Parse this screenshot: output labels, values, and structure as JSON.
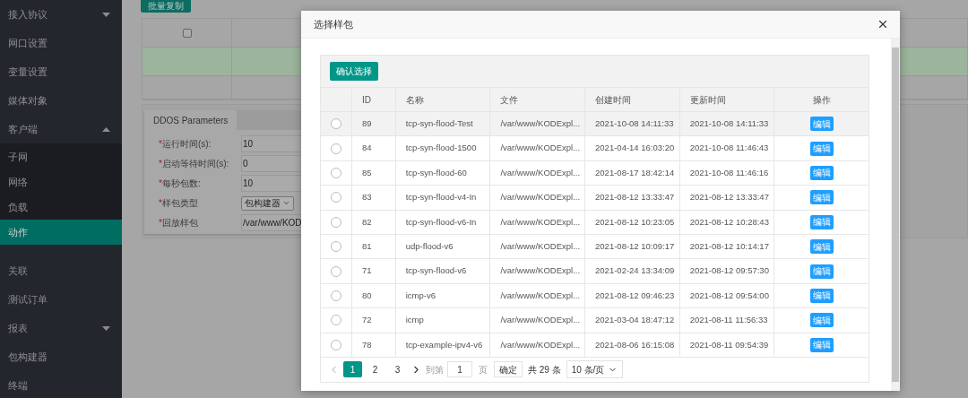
{
  "sidebar": {
    "items": [
      {
        "label": "接入协议",
        "kind": "group",
        "expanded": false,
        "selected": false
      },
      {
        "label": "网口设置",
        "kind": "link",
        "selected": false
      },
      {
        "label": "变量设置",
        "kind": "link",
        "selected": false
      },
      {
        "label": "媒体对象",
        "kind": "link",
        "selected": false
      },
      {
        "label": "客户端",
        "kind": "group",
        "expanded": true,
        "selected": false,
        "children": [
          {
            "label": "子网",
            "selected": false
          },
          {
            "label": "网络",
            "selected": false
          },
          {
            "label": "负载",
            "selected": false
          },
          {
            "label": "动作",
            "selected": true
          }
        ]
      },
      {
        "label": "关联",
        "kind": "link",
        "selected": false
      },
      {
        "label": "测试订单",
        "kind": "link",
        "selected": false
      },
      {
        "label": "报表",
        "kind": "group",
        "expanded": false,
        "selected": false
      },
      {
        "label": "包构建器",
        "kind": "link",
        "selected": false
      },
      {
        "label": "终端",
        "kind": "link",
        "selected": false
      }
    ]
  },
  "page": {
    "batch_button": "批量复制",
    "table": {
      "header_checkbox": {
        "checked": false
      },
      "rows": [
        {
          "selected": true
        },
        {
          "selected": false
        }
      ]
    },
    "params": {
      "tabs": [
        {
          "label": "DDOS Parameters",
          "selected": true
        }
      ],
      "fields": [
        {
          "mark": "*",
          "label": "运行时间(s):",
          "kind": "input",
          "value": "10"
        },
        {
          "mark": "*",
          "label": "启动等待时间(s):",
          "kind": "input",
          "value": "0"
        },
        {
          "mark": "*",
          "label": "每秒包数:",
          "kind": "input",
          "value": "10"
        },
        {
          "mark": "*",
          "label": "样包类型",
          "kind": "select",
          "value": "包构建器"
        },
        {
          "mark": "*",
          "label": "回放样包",
          "kind": "input",
          "value": "/var/www/KOD"
        }
      ]
    }
  },
  "modal": {
    "title": "选择样包",
    "confirm_button": "确认选择",
    "columns": [
      "ID",
      "名称",
      "文件",
      "创建时间",
      "更新时间",
      "操作"
    ],
    "rows": [
      {
        "selected": false,
        "highlighted": true,
        "id": "89",
        "name": "tcp-syn-flood-Test",
        "file": "/var/www/KODExpl...",
        "created": "2021-10-08 14:11:33",
        "updated": "2021-10-08 14:11:33",
        "action": "编辑"
      },
      {
        "selected": false,
        "highlighted": false,
        "id": "84",
        "name": "tcp-syn-flood-1500",
        "file": "/var/www/KODExpl...",
        "created": "2021-04-14 16:03:20",
        "updated": "2021-10-08 11:46:43",
        "action": "编辑"
      },
      {
        "selected": false,
        "highlighted": false,
        "id": "85",
        "name": "tcp-syn-flood-60",
        "file": "/var/www/KODExpl...",
        "created": "2021-08-17 18:42:14",
        "updated": "2021-10-08 11:46:16",
        "action": "编辑"
      },
      {
        "selected": false,
        "highlighted": false,
        "id": "83",
        "name": "tcp-syn-flood-v4-In",
        "file": "/var/www/KODExpl...",
        "created": "2021-08-12 13:33:47",
        "updated": "2021-08-12 13:33:47",
        "action": "编辑"
      },
      {
        "selected": false,
        "highlighted": false,
        "id": "82",
        "name": "tcp-syn-flood-v6-In",
        "file": "/var/www/KODExpl...",
        "created": "2021-08-12 10:23:05",
        "updated": "2021-08-12 10:28:43",
        "action": "编辑"
      },
      {
        "selected": false,
        "highlighted": false,
        "id": "81",
        "name": "udp-flood-v6",
        "file": "/var/www/KODExpl...",
        "created": "2021-08-12 10:09:17",
        "updated": "2021-08-12 10:14:17",
        "action": "编辑"
      },
      {
        "selected": false,
        "highlighted": false,
        "id": "71",
        "name": "tcp-syn-flood-v6",
        "file": "/var/www/KODExpl...",
        "created": "2021-02-24 13:34:09",
        "updated": "2021-08-12 09:57:30",
        "action": "编辑"
      },
      {
        "selected": false,
        "highlighted": false,
        "id": "80",
        "name": "icmp-v6",
        "file": "/var/www/KODExpl...",
        "created": "2021-08-12 09:46:23",
        "updated": "2021-08-12 09:54:00",
        "action": "编辑"
      },
      {
        "selected": false,
        "highlighted": false,
        "id": "72",
        "name": "icmp",
        "file": "/var/www/KODExpl...",
        "created": "2021-03-04 18:47:12",
        "updated": "2021-08-11 11:56:33",
        "action": "编辑"
      },
      {
        "selected": false,
        "highlighted": false,
        "id": "78",
        "name": "tcp-example-ipv4-v6",
        "file": "/var/www/KODExpl...",
        "created": "2021-08-06 16:15:08",
        "updated": "2021-08-11 09:54:39",
        "action": "编辑"
      }
    ],
    "pagination": {
      "prev_disabled": true,
      "pages": [
        {
          "label": "1",
          "selected": true
        },
        {
          "label": "2",
          "selected": false
        },
        {
          "label": "3",
          "selected": false
        }
      ],
      "goto_label": "到第",
      "goto_value": "1",
      "page_unit": "页",
      "confirm": "确定",
      "total": "共 29 条",
      "page_size": "10 条/页"
    }
  }
}
